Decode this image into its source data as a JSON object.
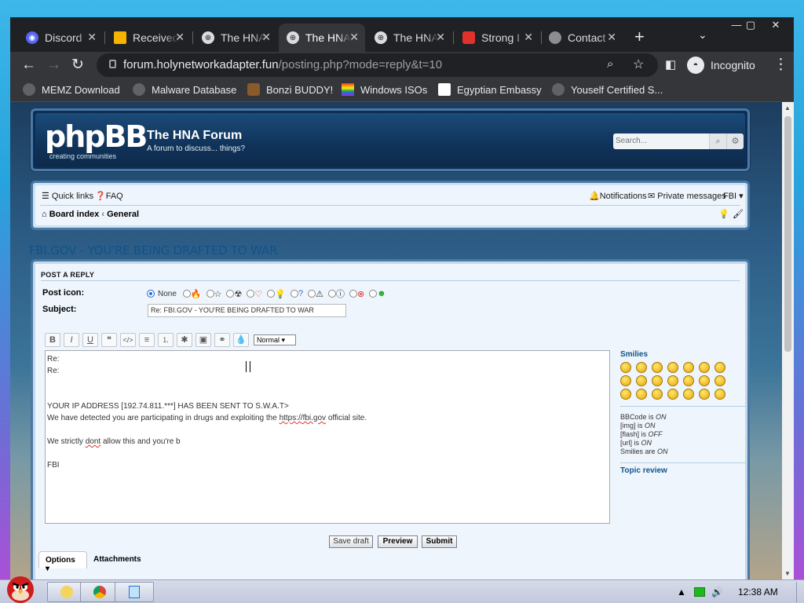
{
  "browser": {
    "tabs": [
      {
        "label": "Discord",
        "active": false,
        "icon": "discord-icon"
      },
      {
        "label": "Received",
        "active": false,
        "icon": "mail-icon"
      },
      {
        "label": "The HNA",
        "active": false,
        "icon": "globe-icon"
      },
      {
        "label": "The HNA",
        "active": true,
        "icon": "globe-icon"
      },
      {
        "label": "The HNA",
        "active": false,
        "icon": "globe-icon"
      },
      {
        "label": "Strong I",
        "active": false,
        "icon": "strong-icon"
      },
      {
        "label": "Contact",
        "active": false,
        "icon": "contact-icon"
      }
    ],
    "url_host": "forum.holynetworkadapter.fun",
    "url_path": "/posting.php?mode=reply&t=10",
    "profile_label": "Incognito",
    "bookmarks": [
      "MEMZ Download",
      "Malware Database",
      "Bonzi BUDDY!",
      "Windows ISOs",
      "Egyptian Embassy",
      "Youself Certified S..."
    ]
  },
  "forum": {
    "logo_text": "phpBB",
    "logo_sub": "creating communities",
    "title": "The HNA Forum",
    "description": "A forum to discuss... things?",
    "search_placeholder": "Search...",
    "quick_links": "Quick links",
    "faq": "FAQ",
    "notifications": "Notifications",
    "private_messages": "Private messages",
    "user": "FBI",
    "breadcrumb_index": "Board index",
    "breadcrumb_forum": "General",
    "topic_title": "FBI.GOV - YOU'RE BEING DRAFTED TO WAR"
  },
  "reply_form": {
    "heading": "POST A REPLY",
    "post_icon_label": "Post icon:",
    "post_icon_none": "None",
    "subject_label": "Subject:",
    "subject_value": "Re: FBI.GOV - YOU'RE BEING DRAFTED TO WAR",
    "font_size_value": "Normal",
    "editor_lines": [
      "Re:",
      "Re:",
      "",
      "",
      "YOUR IP ADDRESS [192.74.811.***] HAS BEEN SENT TO S.W.A.T>",
      "We have detected you are participating in drugs and exploiting the https://fbi.gov official site.",
      "",
      "We strictly dont allow this and you're b",
      "",
      "FBI"
    ],
    "smilies_title": "Smilies",
    "bbcode_status": [
      {
        "label": "BBCode is ",
        "value": "ON"
      },
      {
        "label": "[img] is ",
        "value": "ON"
      },
      {
        "label": "[flash] is ",
        "value": "OFF"
      },
      {
        "label": "[url] is ",
        "value": "ON"
      },
      {
        "label": "Smilies are ",
        "value": "ON"
      }
    ],
    "topic_review": "Topic review",
    "save_draft": "Save draft",
    "preview": "Preview",
    "submit": "Submit",
    "options_tab": "Options",
    "attachments_tab": "Attachments"
  },
  "taskbar": {
    "clock": "12:38 AM"
  },
  "colors": {
    "link": "#105289",
    "header_bg": "#10335a",
    "panel_bg": "#eef5fc"
  }
}
